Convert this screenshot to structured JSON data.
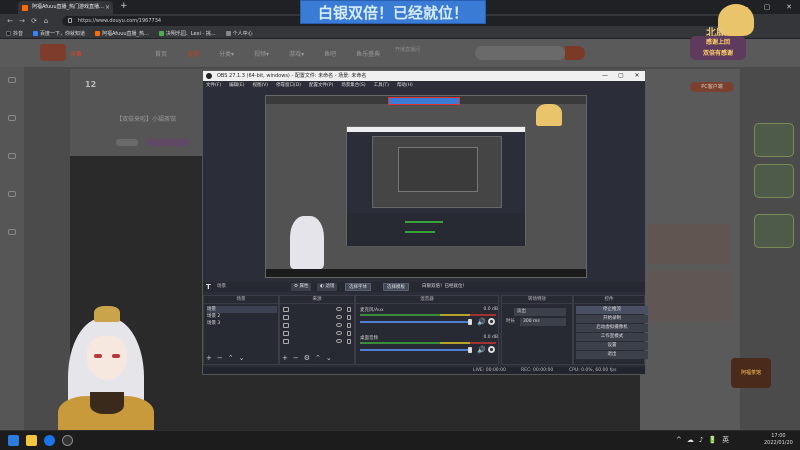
{
  "browser": {
    "tab_title": "阿福Afuuu直播_热门游戏直播...",
    "tab_close": "×",
    "new_tab": "+",
    "url": "https://www.douyu.com/1967734",
    "win_controls": [
      "—",
      "▢",
      "✕"
    ],
    "nav": [
      "←",
      "→",
      "⟳",
      "⌂"
    ],
    "bookmarks": [
      {
        "label": "抖音",
        "color": "#222222"
      },
      {
        "label": "百度一下，你就知道",
        "color": "#3385ff"
      },
      {
        "label": "阿福Afuuu直播_热...",
        "color": "#ff6d00"
      },
      {
        "label": "决明乐园、Lexi - 挑...",
        "color": "#4caf50"
      },
      {
        "label": "个人中心",
        "color": "#888888"
      }
    ]
  },
  "douyu": {
    "logo_text": "斗鱼",
    "nav": [
      "首页",
      "直播",
      "分类▾",
      "视频▾",
      "游戏▾",
      "鱼吧",
      "鱼乐盛典"
    ],
    "active_nav": 1,
    "enter_room": "开播直播间",
    "room_number": "12",
    "room_title": "【双倍来啦】小福茶馆",
    "pc_button": "PC客户端"
  },
  "overlay": {
    "banner": "白银双倍！已经就位！",
    "brand": "北鹿",
    "sticker_lines": [
      "感谢上回",
      "双倍有感谢"
    ],
    "corner_logo": "阿福茶馆"
  },
  "obs": {
    "title": "OBS 27.1.3 (64-bit, windows) - 配置文件: 未命名 - 场景: 未命名",
    "menu": [
      "文件(F)",
      "编辑(E)",
      "视图(V)",
      "停靠窗口(D)",
      "配置文件(P)",
      "场景集合(S)",
      "工具(T)",
      "帮助(H)"
    ],
    "scene_bar": {
      "scene_label": "场景",
      "buttons": [
        "⚙ 属性",
        "◐ 滤镜",
        "选择字体",
        "选择模板"
      ],
      "message": "白银双倍！已经就位！"
    },
    "docks": {
      "scenes": {
        "title": "场景",
        "items": [
          "场景",
          "场景 2",
          "场景 3"
        ]
      },
      "sources": {
        "title": "来源"
      },
      "mixer": {
        "title": "混音器",
        "channels": [
          {
            "name": "麦克风/Aux",
            "db": "0.0 dB"
          },
          {
            "name": "桌面音频",
            "db": "0.0 dB"
          }
        ]
      },
      "transitions": {
        "title": "转场特效",
        "type_value": "淡出",
        "duration_label": "时长",
        "duration_value": "300 ms"
      },
      "controls": {
        "title": "控件",
        "buttons": [
          "停止推流",
          "开始录制",
          "启动虚拟摄像机",
          "工作室模式",
          "设置",
          "退出"
        ]
      }
    },
    "status": {
      "live": "LIVE: 00:00:00",
      "rec": "REC: 00:00:00",
      "cpu": "CPU: 0.0%, 60.00 fps"
    }
  },
  "taskbar": {
    "tray": [
      "^",
      "☁",
      "♪",
      "🔋",
      "英"
    ],
    "time": "17:00",
    "date": "2022/01/20"
  },
  "colors": {
    "accent_blue": "#3a7bd5",
    "douyu_orange": "#b84026",
    "obs_bg": "#2b2e38"
  }
}
